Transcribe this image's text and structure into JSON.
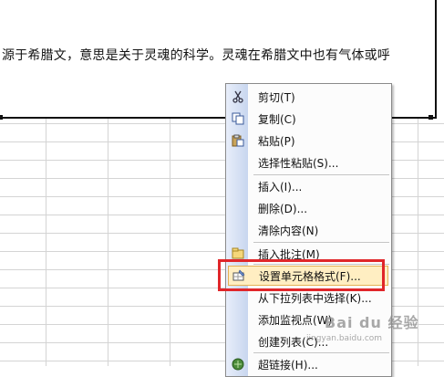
{
  "document": {
    "textbox_text": "源于希腊文，意思是关于灵魂的科学。灵魂在希腊文中也有气体或呼"
  },
  "context_menu": {
    "items": [
      {
        "label": "剪切(T)",
        "icon": "scissors-icon"
      },
      {
        "label": "复制(C)",
        "icon": "copy-icon"
      },
      {
        "label": "粘贴(P)",
        "icon": "paste-icon"
      },
      {
        "label": "选择性粘贴(S)..."
      },
      {
        "label": "插入(I)..."
      },
      {
        "label": "删除(D)..."
      },
      {
        "label": "清除内容(N)"
      },
      {
        "label": "插入批注(M)",
        "icon": "insert-comment-icon"
      },
      {
        "label": "设置单元格格式(F)...",
        "icon": "format-cells-icon",
        "highlighted": true
      },
      {
        "label": "从下拉列表中选择(K)..."
      },
      {
        "label": "添加监视点(W)"
      },
      {
        "label": "创建列表(C)..."
      },
      {
        "label": "超链接(H)...",
        "icon": "hyperlink-icon"
      }
    ]
  },
  "watermark": {
    "logo": "Bai du 经验",
    "url": "jingyan.baidu.com"
  },
  "colors": {
    "highlight_border": "#e0262a",
    "hover_fill": "#ffeec2"
  }
}
